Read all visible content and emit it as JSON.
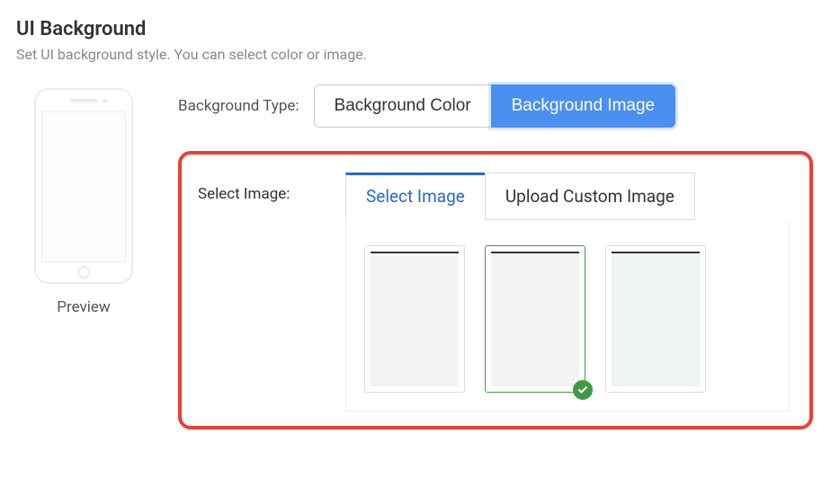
{
  "header": {
    "title": "UI Background",
    "subtitle": "Set UI background style. You can select color or image."
  },
  "preview": {
    "label": "Preview"
  },
  "backgroundType": {
    "label": "Background Type:",
    "options": [
      "Background Color",
      "Background Image"
    ],
    "selected": "Background Image"
  },
  "selectImage": {
    "label": "Select Image:",
    "tabs": [
      "Select Image",
      "Upload Custom Image"
    ],
    "activeTab": "Select Image",
    "thumbnails": [
      {
        "id": "plain-1",
        "selected": false,
        "variant": "plain"
      },
      {
        "id": "plain-2",
        "selected": true,
        "variant": "plain"
      },
      {
        "id": "blue-1",
        "selected": false,
        "variant": "blue"
      }
    ]
  },
  "colors": {
    "accent": "#4b8ff0",
    "tabAccent": "#2468d8",
    "highlight": "#e94034",
    "success": "#3d9b45"
  }
}
